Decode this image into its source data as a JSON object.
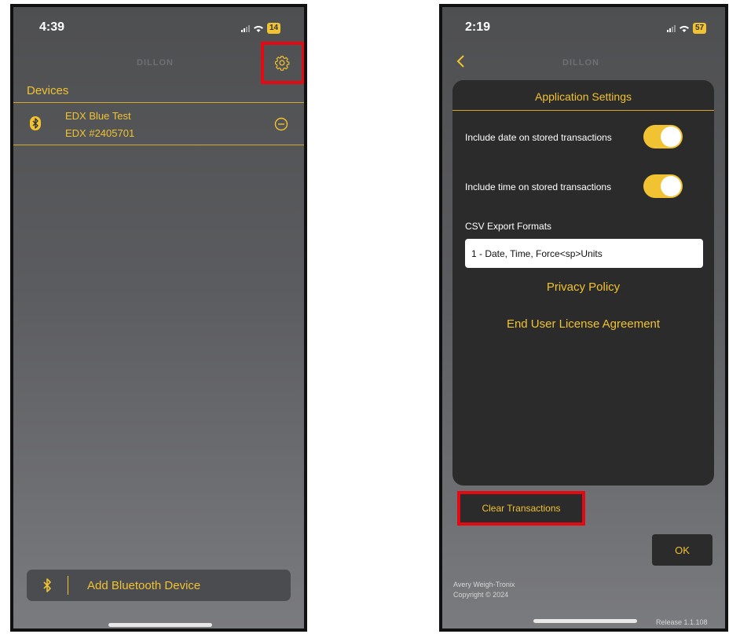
{
  "screen1": {
    "status": {
      "time": "4:39",
      "battery": "14"
    },
    "brand": "DILLON",
    "devices_label": "Devices",
    "device": {
      "name": "EDX Blue Test",
      "id": "EDX #2405701"
    },
    "add_button_label": "Add Bluetooth Device"
  },
  "screen2": {
    "status": {
      "time": "2:19",
      "battery": "57"
    },
    "brand": "DILLON",
    "panel_title": "Application Settings",
    "settings": {
      "include_date": {
        "label": "Include date on stored transactions",
        "enabled": true
      },
      "include_time": {
        "label": "Include time on stored transactions",
        "enabled": true
      }
    },
    "csv_label": "CSV Export Formats",
    "csv_value": "1 - Date, Time, Force<sp>Units",
    "privacy_policy": "Privacy Policy",
    "eula": "End User License Agreement",
    "clear_transactions": "Clear Transactions",
    "ok_label": "OK",
    "footer": {
      "company": "Avery Weigh-Tronix",
      "copyright": "Copyright © 2024",
      "release": "Release 1.1.108"
    }
  },
  "colors": {
    "accent": "#f1c232",
    "highlight": "#e50914",
    "panel": "#2b2b2c"
  }
}
